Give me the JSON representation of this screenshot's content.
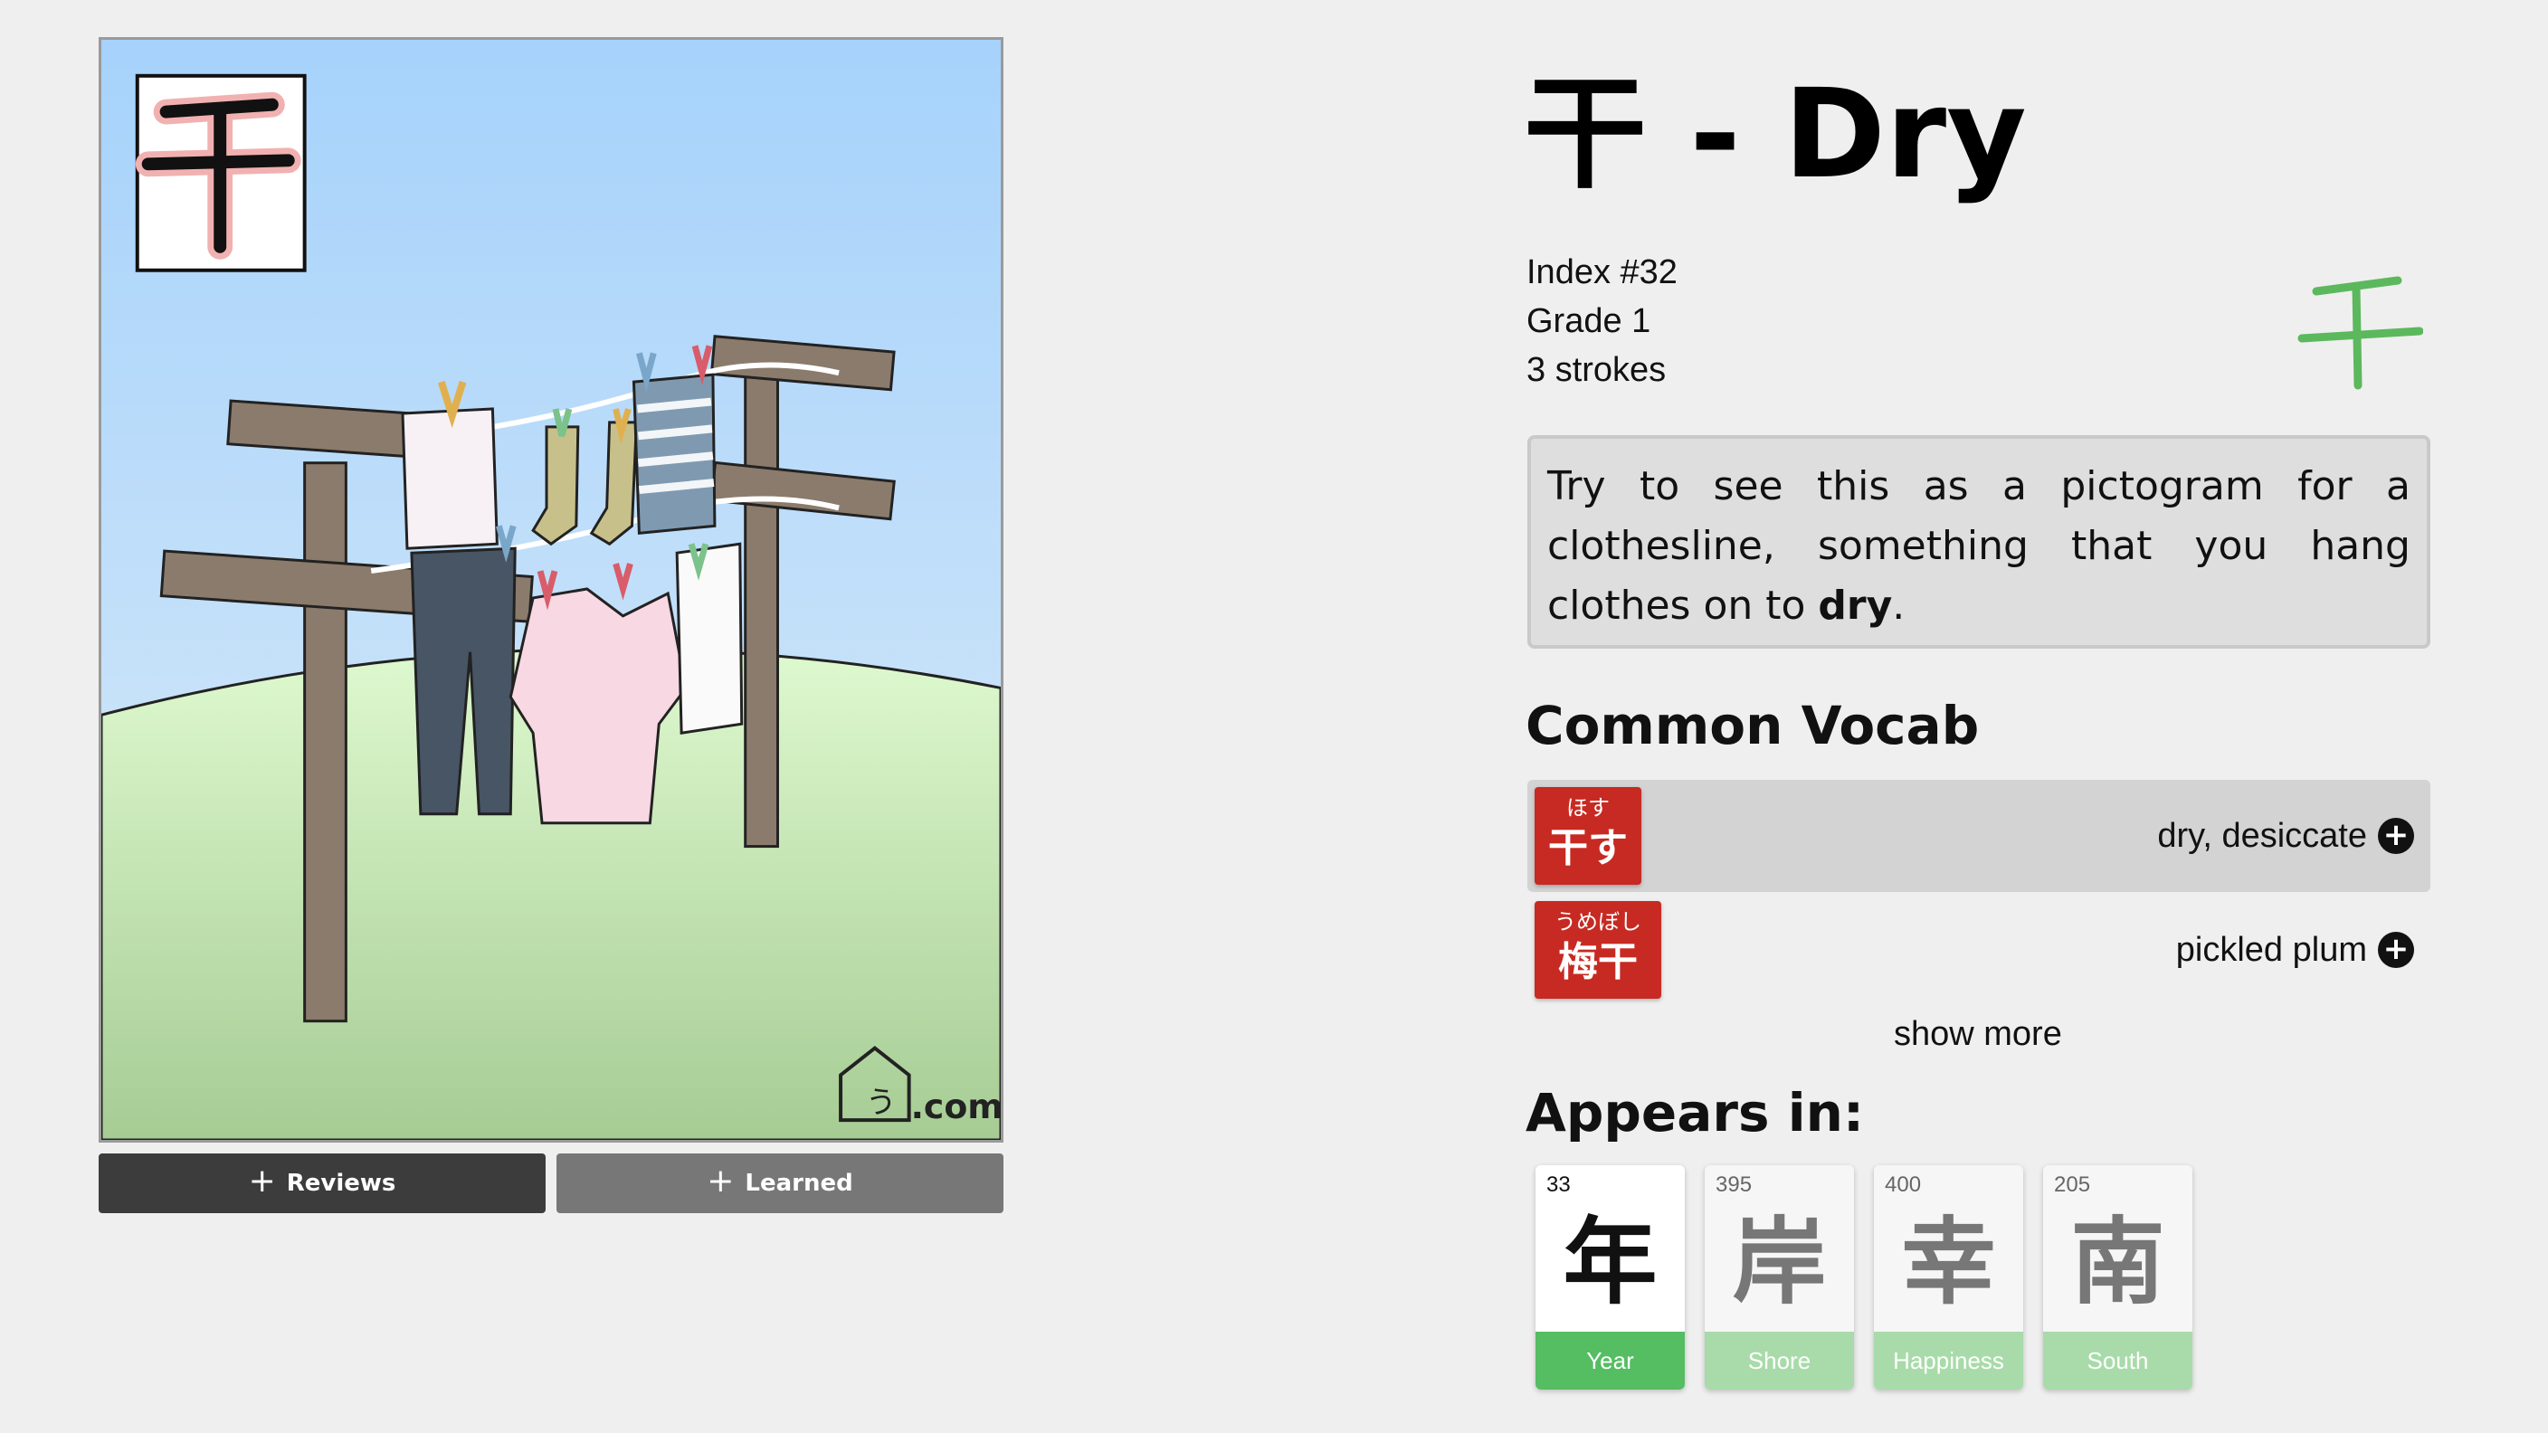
{
  "illustration": {
    "kanji": "干",
    "watermark": ".com"
  },
  "buttons": {
    "reviews": "Reviews",
    "learned": "Learned"
  },
  "kanji": {
    "title": "干 - Dry",
    "index": "Index #32",
    "grade": "Grade 1",
    "strokes": "3 strokes",
    "glyph": "干",
    "glyph_color": "#5cb85c"
  },
  "mnemonic": {
    "before": "Try to see this as a pictogram for a clothesline, something that you hang clothes on to ",
    "bold": "dry",
    "after": "."
  },
  "vocab": {
    "heading": "Common Vocab",
    "items": [
      {
        "furigana": "ほす",
        "word": "干す",
        "meaning": "dry, desiccate"
      },
      {
        "furigana": "うめぼし",
        "word": "梅干",
        "meaning": "pickled plum"
      }
    ],
    "show_more": "show more",
    "chip_color": "#c72a22"
  },
  "appears": {
    "heading": "Appears in:",
    "cards": [
      {
        "number": "33",
        "kanji": "年",
        "meaning": "Year"
      },
      {
        "number": "395",
        "kanji": "岸",
        "meaning": "Shore"
      },
      {
        "number": "400",
        "kanji": "幸",
        "meaning": "Happiness"
      },
      {
        "number": "205",
        "kanji": "南",
        "meaning": "South"
      }
    ]
  }
}
